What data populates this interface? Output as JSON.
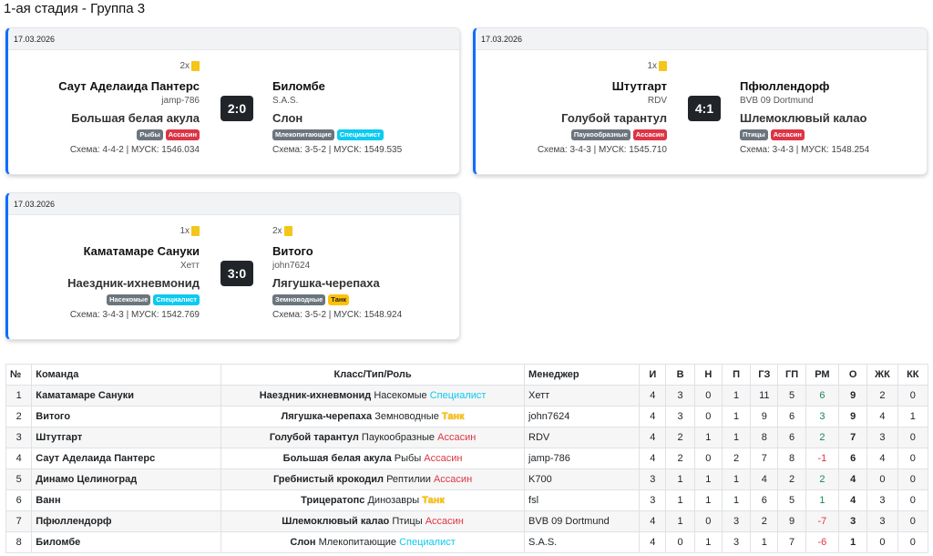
{
  "stage_title": "1-ая стадия - Группа 3",
  "matches": [
    {
      "date": "17.03.2026",
      "score": "2:0",
      "home": {
        "cards": "2x",
        "team": "Саут Аделаида Пантерс",
        "manager": "jamp-786",
        "animal": "Большая белая акула",
        "badges": [
          {
            "text": "Рыбы",
            "color": "gray"
          },
          {
            "text": "Ассасин",
            "color": "red"
          }
        ],
        "scheme": "Схема: 4-4-2 | МУСК: 1546.034"
      },
      "away": {
        "cards": "",
        "team": "Биломбе",
        "manager": "S.A.S.",
        "animal": "Слон",
        "badges": [
          {
            "text": "Млекопитающие",
            "color": "gray"
          },
          {
            "text": "Специалист",
            "color": "cyan"
          }
        ],
        "scheme": "Схема: 3-5-2 | МУСК: 1549.535"
      }
    },
    {
      "date": "17.03.2026",
      "score": "4:1",
      "home": {
        "cards": "1x",
        "team": "Штутгарт",
        "manager": "RDV",
        "animal": "Голубой тарантул",
        "badges": [
          {
            "text": "Паукообразные",
            "color": "gray"
          },
          {
            "text": "Ассасин",
            "color": "red"
          }
        ],
        "scheme": "Схема: 3-4-3 | МУСК: 1545.710"
      },
      "away": {
        "cards": "",
        "team": "Пфюллендорф",
        "manager": "BVB 09 Dortmund",
        "animal": "Шлемоклювый калао",
        "badges": [
          {
            "text": "Птицы",
            "color": "gray"
          },
          {
            "text": "Ассасин",
            "color": "red"
          }
        ],
        "scheme": "Схема: 3-4-3 | МУСК: 1548.254"
      }
    },
    {
      "date": "17.03.2026",
      "score": "3:0",
      "home": {
        "cards": "1x",
        "team": "Каматамаре Сануки",
        "manager": "Хетт",
        "animal": "Наездник-ихневмонид",
        "badges": [
          {
            "text": "Насекомые",
            "color": "gray"
          },
          {
            "text": "Специалист",
            "color": "cyan"
          }
        ],
        "scheme": "Схема: 3-4-3 | МУСК: 1542.769"
      },
      "away": {
        "cards": "2x",
        "team": "Витого",
        "manager": "john7624",
        "animal": "Лягушка-черепаха",
        "badges": [
          {
            "text": "Земноводные",
            "color": "gray"
          },
          {
            "text": "Танк",
            "color": "yellow"
          }
        ],
        "scheme": "Схема: 3-5-2 | МУСК: 1548.924"
      }
    }
  ],
  "table": {
    "headers": [
      "№",
      "Команда",
      "Класс/Тип/Роль",
      "Менеджер",
      "И",
      "В",
      "Н",
      "П",
      "ГЗ",
      "ГП",
      "РМ",
      "О",
      "ЖК",
      "КК"
    ],
    "rows": [
      {
        "n": "1",
        "team": "Каматамаре Сануки",
        "cls": "Наездник-ихневмонид",
        "type": "Насекомые",
        "role": "Специалист",
        "role_color": "cyan",
        "manager": "Хетт",
        "i": "4",
        "w": "3",
        "d": "0",
        "l": "1",
        "gf": "11",
        "ga": "5",
        "rm": "6",
        "rm_sign": "pos",
        "pts": "9",
        "yc": "2",
        "rc": "0"
      },
      {
        "n": "2",
        "team": "Витого",
        "cls": "Лягушка-черепаха",
        "type": "Земноводные",
        "role": "Танк",
        "role_color": "yellow",
        "manager": "john7624",
        "i": "4",
        "w": "3",
        "d": "0",
        "l": "1",
        "gf": "9",
        "ga": "6",
        "rm": "3",
        "rm_sign": "pos",
        "pts": "9",
        "yc": "4",
        "rc": "1"
      },
      {
        "n": "3",
        "team": "Штутгарт",
        "cls": "Голубой тарантул",
        "type": "Паукообразные",
        "role": "Ассасин",
        "role_color": "red",
        "manager": "RDV",
        "i": "4",
        "w": "2",
        "d": "1",
        "l": "1",
        "gf": "8",
        "ga": "6",
        "rm": "2",
        "rm_sign": "pos",
        "pts": "7",
        "yc": "3",
        "rc": "0"
      },
      {
        "n": "4",
        "team": "Саут Аделаида Пантерс",
        "cls": "Большая белая акула",
        "type": "Рыбы",
        "role": "Ассасин",
        "role_color": "red",
        "manager": "jamp-786",
        "i": "4",
        "w": "2",
        "d": "0",
        "l": "2",
        "gf": "7",
        "ga": "8",
        "rm": "-1",
        "rm_sign": "neg",
        "pts": "6",
        "yc": "4",
        "rc": "0"
      },
      {
        "n": "5",
        "team": "Динамо Целиноград",
        "cls": "Гребнистый крокодил",
        "type": "Рептилии",
        "role": "Ассасин",
        "role_color": "red",
        "manager": "K700",
        "i": "3",
        "w": "1",
        "d": "1",
        "l": "1",
        "gf": "4",
        "ga": "2",
        "rm": "2",
        "rm_sign": "pos",
        "pts": "4",
        "yc": "0",
        "rc": "0"
      },
      {
        "n": "6",
        "team": "Ванн",
        "cls": "Трицератопс",
        "type": "Динозавры",
        "role": "Танк",
        "role_color": "yellow",
        "manager": "fsl",
        "i": "3",
        "w": "1",
        "d": "1",
        "l": "1",
        "gf": "6",
        "ga": "5",
        "rm": "1",
        "rm_sign": "pos",
        "pts": "4",
        "yc": "3",
        "rc": "0"
      },
      {
        "n": "7",
        "team": "Пфюллендорф",
        "cls": "Шлемоклювый калао",
        "type": "Птицы",
        "role": "Ассасин",
        "role_color": "red",
        "manager": "BVB 09 Dortmund",
        "i": "4",
        "w": "1",
        "d": "0",
        "l": "3",
        "gf": "2",
        "ga": "9",
        "rm": "-7",
        "rm_sign": "neg",
        "pts": "3",
        "yc": "3",
        "rc": "0"
      },
      {
        "n": "8",
        "team": "Биломбе",
        "cls": "Слон",
        "type": "Млекопитающие",
        "role": "Специалист",
        "role_color": "cyan",
        "manager": "S.A.S.",
        "i": "4",
        "w": "0",
        "d": "1",
        "l": "3",
        "gf": "1",
        "ga": "7",
        "rm": "-6",
        "rm_sign": "neg",
        "pts": "1",
        "yc": "0",
        "rc": "0"
      }
    ]
  }
}
